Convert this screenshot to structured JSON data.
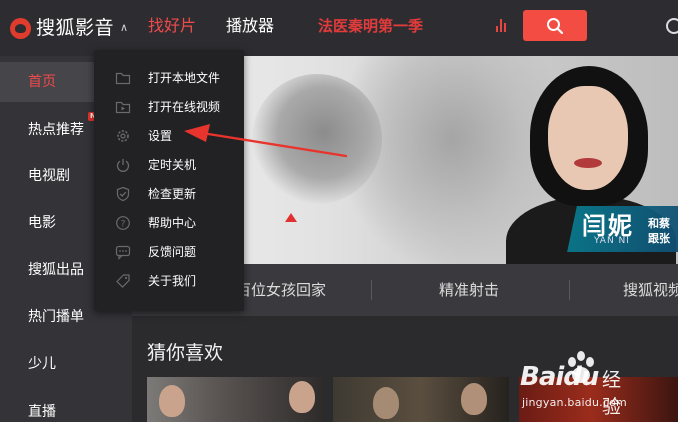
{
  "app": {
    "name": "搜狐影音",
    "colors": {
      "accent": "#f04a4a",
      "topbar": "#2d2d31",
      "sidebar": "#333338",
      "menu": "#222225",
      "search": "#f24c43"
    }
  },
  "header": {
    "nav": {
      "find": "找好片",
      "player": "播放器",
      "hot_show": "法医秦明第一季"
    },
    "icons": {
      "chart": "bar-chart-icon",
      "search": "search-icon",
      "record": "record-icon"
    }
  },
  "sidebar": {
    "items": [
      {
        "label": "首页",
        "active": true
      },
      {
        "label": "热点推荐",
        "badge": "NEW"
      },
      {
        "label": "电视剧"
      },
      {
        "label": "电影"
      },
      {
        "label": "搜狐出品"
      },
      {
        "label": "热门播单"
      },
      {
        "label": "少儿"
      },
      {
        "label": "直播"
      }
    ]
  },
  "menu": {
    "items": [
      {
        "label": "打开本地文件",
        "icon": "folder-icon"
      },
      {
        "label": "打开在线视频",
        "icon": "play-folder-icon"
      },
      {
        "label": "设置",
        "icon": "gear-icon"
      },
      {
        "label": "定时关机",
        "icon": "power-icon"
      },
      {
        "label": "检查更新",
        "icon": "shield-check-icon"
      },
      {
        "label": "帮助中心",
        "icon": "help-icon"
      },
      {
        "label": "反馈问题",
        "icon": "feedback-icon"
      },
      {
        "label": "关于我们",
        "icon": "tag-icon"
      }
    ]
  },
  "banner": {
    "name_cn": "闫妮",
    "name_en": "YAN NI",
    "side_line1": "和蔡",
    "side_line2": "跟张"
  },
  "tabs": [
    {
      "label": "送一百位女孩回家"
    },
    {
      "label": "精准射击"
    },
    {
      "label": "搜狐视频"
    }
  ],
  "recommend": {
    "title": "猜你喜欢"
  },
  "watermark": {
    "brand": "Baidu",
    "product": "经验",
    "url": "jingyan.baidu.com"
  }
}
